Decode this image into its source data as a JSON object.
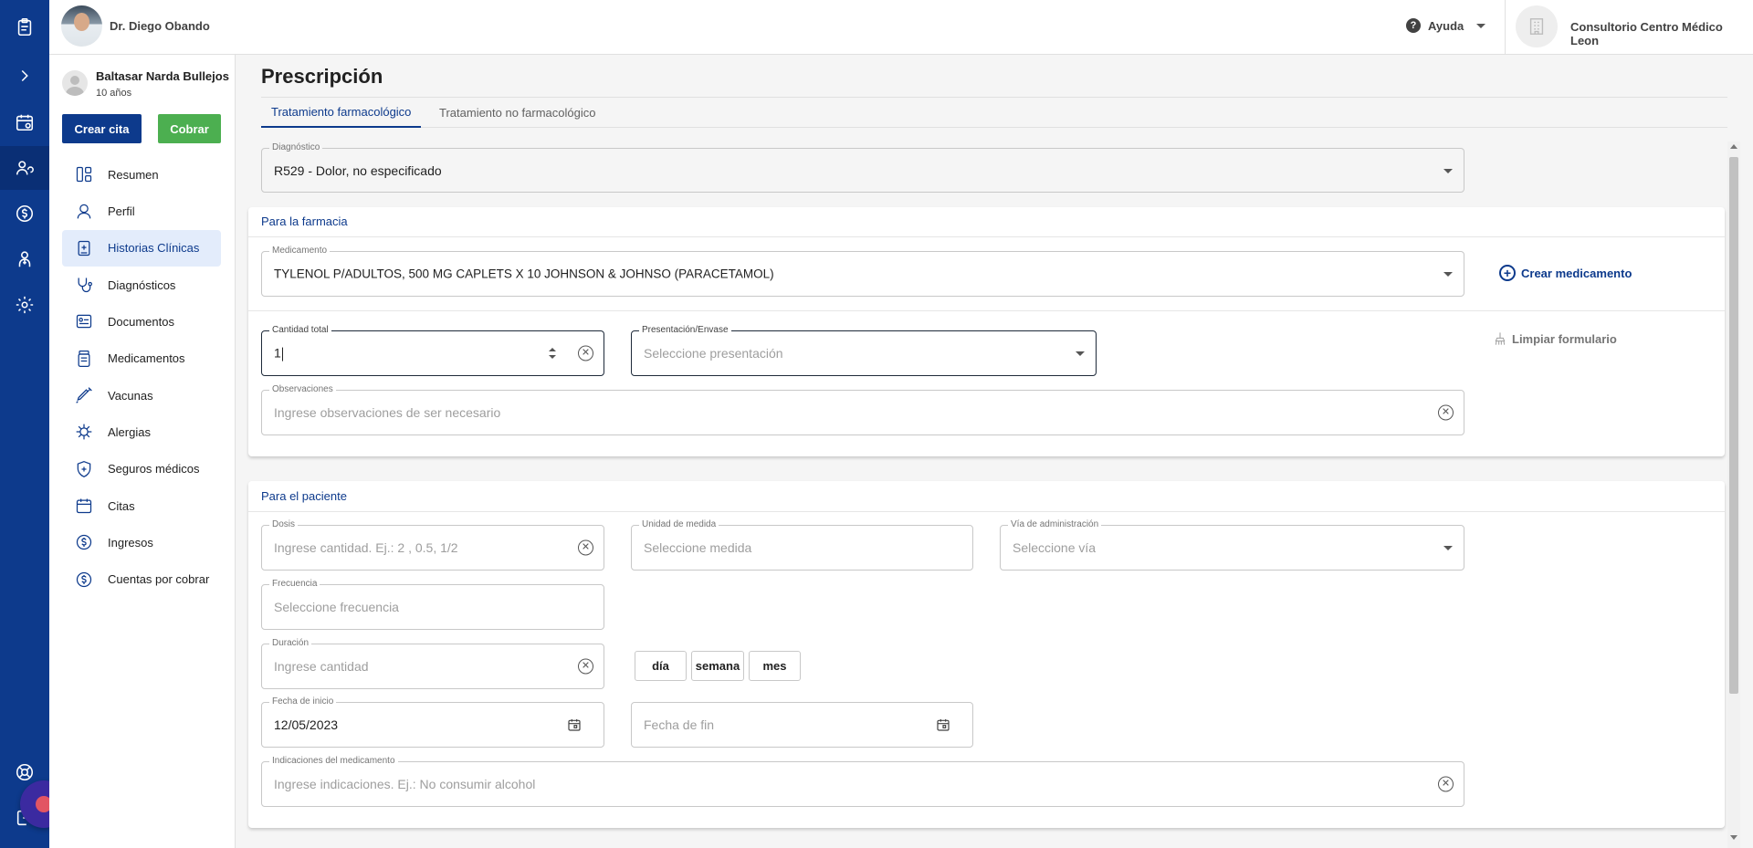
{
  "rail": {
    "icons": [
      "clipboard-icon",
      "expand-icon",
      "calendar-icon",
      "patients-icon",
      "billing-icon",
      "doctor-icon",
      "settings-icon",
      "support-icon",
      "logout-icon"
    ]
  },
  "header": {
    "doctor_name": "Dr. Diego Obando",
    "help_label": "Ayuda",
    "clinic_name": "Consultorio Centro Médico Leon"
  },
  "patient": {
    "name": "Baltasar Narda Bullejos",
    "age": "10 años"
  },
  "actions": {
    "create_appointment": "Crear cita",
    "charge": "Cobrar"
  },
  "nav": {
    "items": [
      {
        "label": "Resumen",
        "icon": "summary-icon"
      },
      {
        "label": "Perfil",
        "icon": "profile-icon"
      },
      {
        "label": "Historias Clínicas",
        "icon": "medical-record-icon",
        "active": true
      },
      {
        "label": "Diagnósticos",
        "icon": "stethoscope-icon"
      },
      {
        "label": "Documentos",
        "icon": "documents-icon"
      },
      {
        "label": "Medicamentos",
        "icon": "medication-icon"
      },
      {
        "label": "Vacunas",
        "icon": "syringe-icon"
      },
      {
        "label": "Alergias",
        "icon": "allergy-icon"
      },
      {
        "label": "Seguros médicos",
        "icon": "insurance-icon"
      },
      {
        "label": "Citas",
        "icon": "appointments-icon"
      },
      {
        "label": "Ingresos",
        "icon": "income-icon"
      },
      {
        "label": "Cuentas por cobrar",
        "icon": "receivables-icon"
      }
    ]
  },
  "page": {
    "title": "Prescripción",
    "tabs": [
      {
        "label": "Tratamiento farmacológico",
        "active": true
      },
      {
        "label": "Tratamiento no farmacológico",
        "active": false
      }
    ]
  },
  "diagnosis": {
    "label": "Diagnóstico",
    "value": "R529 - Dolor, no especificado"
  },
  "pharmacy": {
    "section_title": "Para la farmacia",
    "medication_label": "Medicamento",
    "medication_value": "TYLENOL P/ADULTOS, 500 MG CAPLETS X 10 JOHNSON & JOHNSO (PARACETAMOL)",
    "create_medication": "Crear medicamento",
    "quantity_label": "Cantidad total",
    "quantity_value": "1",
    "presentation_label": "Presentación/Envase",
    "presentation_placeholder": "Seleccione presentación",
    "clear_form": "Limpiar formulario",
    "observations_label": "Observaciones",
    "observations_placeholder": "Ingrese observaciones de ser necesario"
  },
  "patient_section": {
    "section_title": "Para el paciente",
    "dose_label": "Dosis",
    "dose_placeholder": "Ingrese cantidad. Ej.: 2 , 0.5, 1/2",
    "unit_label": "Unidad de medida",
    "unit_placeholder": "Seleccione medida",
    "route_label": "Vía de administración",
    "route_placeholder": "Seleccione vía",
    "frequency_label": "Frecuencia",
    "frequency_placeholder": "Seleccione frecuencia",
    "duration_label": "Duración",
    "duration_placeholder": "Ingrese cantidad",
    "duration_units": [
      "día",
      "semana",
      "mes"
    ],
    "start_label": "Fecha de inicio",
    "start_value": "12/05/2023",
    "end_placeholder": "Fecha de fin",
    "indications_label": "Indicaciones del medicamento",
    "indications_placeholder": "Ingrese indicaciones. Ej.: No consumir alcohol"
  },
  "colors": {
    "primary": "#0d3a8c",
    "success": "#4caf50",
    "active_nav_bg": "#e3ecfb"
  }
}
